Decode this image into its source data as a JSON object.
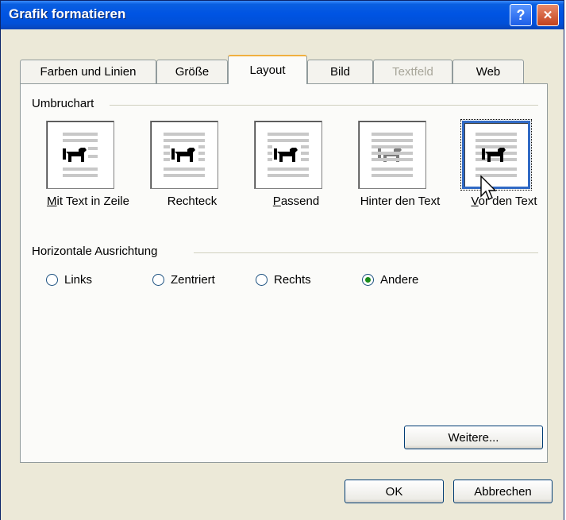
{
  "window": {
    "title": "Grafik formatieren",
    "help_label": "?",
    "close_label": "✕"
  },
  "tabs": [
    {
      "label": "Farben und Linien",
      "state": "normal"
    },
    {
      "label": "Größe",
      "state": "normal"
    },
    {
      "label": "Layout",
      "state": "active"
    },
    {
      "label": "Bild",
      "state": "normal"
    },
    {
      "label": "Textfeld",
      "state": "disabled"
    },
    {
      "label": "Web",
      "state": "normal"
    }
  ],
  "wrap_group": {
    "label": "Umbruchart",
    "options": [
      {
        "label": "Mit Text in Zeile",
        "icon": "inline-dog-icon"
      },
      {
        "label": "Rechteck",
        "icon": "square-wrap-dog-icon"
      },
      {
        "label": "Passend",
        "icon": "tight-wrap-dog-icon"
      },
      {
        "label": "Hinter den Text",
        "icon": "behind-text-dog-icon"
      },
      {
        "label": "Vor den Text",
        "icon": "in-front-dog-icon",
        "selected": true
      }
    ]
  },
  "align_group": {
    "label": "Horizontale Ausrichtung",
    "options": [
      {
        "label": "Links",
        "checked": false
      },
      {
        "label": "Zentriert",
        "checked": false
      },
      {
        "label": "Rechts",
        "checked": false
      },
      {
        "label": "Andere",
        "checked": true
      }
    ]
  },
  "buttons": {
    "more_label": "Weitere...",
    "ok_label": "OK",
    "cancel_label": "Abbrechen"
  },
  "colors": {
    "title_bar": "#0054e3",
    "dialog_bg": "#ece9d8",
    "selection": "#316ac5"
  }
}
